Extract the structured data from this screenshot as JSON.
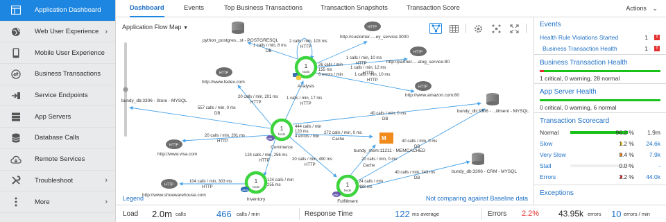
{
  "sidebar": {
    "items": [
      {
        "label": "Application Dashboard",
        "icon": "dashboard-icon",
        "has_submenu": false,
        "active": true
      },
      {
        "label": "Web User Experience",
        "icon": "globe-icon",
        "has_submenu": true
      },
      {
        "label": "Mobile User Experience",
        "icon": "mobile-icon",
        "has_submenu": false
      },
      {
        "label": "Business Transactions",
        "icon": "transactions-icon",
        "has_submenu": false
      },
      {
        "label": "Service Endpoints",
        "icon": "endpoint-icon",
        "has_submenu": false
      },
      {
        "label": "App Servers",
        "icon": "server-icon",
        "has_submenu": false
      },
      {
        "label": "Database Calls",
        "icon": "database-icon",
        "has_submenu": false
      },
      {
        "label": "Remote Services",
        "icon": "cloud-icon",
        "has_submenu": false
      },
      {
        "label": "Troubleshoot",
        "icon": "wrench-icon",
        "has_submenu": true
      },
      {
        "label": "More",
        "icon": "more-icon",
        "has_submenu": true
      }
    ]
  },
  "tabs": [
    {
      "label": "Dashboard",
      "active": true
    },
    {
      "label": "Events"
    },
    {
      "label": "Top Business Transactions"
    },
    {
      "label": "Transaction Snapshots"
    },
    {
      "label": "Transaction Score"
    }
  ],
  "actions_label": "Actions",
  "flow_map": {
    "title": "Application Flow Map",
    "legend": "Legend",
    "baseline_note": "Not comparing against Baseline data",
    "nodes": [
      {
        "id": "analysis",
        "count": "1",
        "unit": "Node",
        "name": "Analysis",
        "badge": "py"
      },
      {
        "id": "commerce",
        "count": "1",
        "unit": "Node",
        "name": "Commerce",
        "badge": "php"
      },
      {
        "id": "inventory",
        "count": "1",
        "unit": "Node",
        "name": "Inventory",
        "badge": "Java"
      },
      {
        "id": "fulfillment",
        "count": "1",
        "unit": "Node",
        "name": "Fulfillment",
        "badge": "php"
      }
    ],
    "backends": [
      {
        "label": "python_postgres...st - POSTGRESQL",
        "kind": "db"
      },
      {
        "label": "http://customer.....ey_service:3000",
        "kind": "http"
      },
      {
        "label": "http://partner.....alog_service:80",
        "kind": "http"
      },
      {
        "label": "http://www.fedex.com",
        "kind": "http"
      },
      {
        "label": "http://www.amazon.com:80",
        "kind": "http"
      },
      {
        "label": "bundy_db:3306 - Store - MYSQL",
        "kind": "db"
      },
      {
        "label": "bundy_db:3306 - ...illment - MYSQL",
        "kind": "db"
      },
      {
        "label": "http://www.visa.com",
        "kind": "http"
      },
      {
        "label": "bundy_mem:11211 - MEMCACHED",
        "kind": "cache"
      },
      {
        "label": "http://www.shoewarehouse.com",
        "kind": "http"
      },
      {
        "label": "bundy_db:3306 - CRM - MYSQL",
        "kind": "db"
      }
    ],
    "edge_labels": {
      "a_db": [
        "1 calls / min, 8 ms",
        "DB"
      ],
      "a_self": [
        "2 calls / min, 103 ms",
        "HTTP"
      ],
      "a_cust": [
        "1 calls / min, 10 ms",
        "HTTP"
      ],
      "a_partner": [
        "1 calls / min, 12 ms",
        "HTTP"
      ],
      "a_errors": [
        "26 calls / min",
        "155 ms",
        "6 errors / min"
      ],
      "a_amazon": [
        "1 calls / min, 10 ms",
        "HTTP"
      ],
      "c_fedex": [
        "20 calls / min, 201 ms",
        "HTTP"
      ],
      "c_analysis": [
        "1 calls / min, 17 ms",
        "HTTP"
      ],
      "c_store": [
        "557 calls / min, 0 ms",
        "DB"
      ],
      "c_fulfdb": [
        "40 calls / min, 0 ms",
        "DB"
      ],
      "c_stats": [
        "444 calls / min",
        "120 ms",
        "4 errors / min"
      ],
      "c_cache": [
        "272 calls / min, 0 ms",
        "Cache"
      ],
      "c_visa": [
        "20 calls / min, 201 ms",
        "HTTP"
      ],
      "c_inv": [
        "124 calls / min, 256 ms",
        "HTTP"
      ],
      "c_fulf": [
        "20 calls / min, 490 ms",
        "HTTP"
      ],
      "f_cache": [
        "20 calls / min, 0 ms",
        "Cache"
      ],
      "f_fulfdb": [
        "40 calls / min, 0 ms",
        "DB"
      ],
      "f_stats": [
        "24 calls / min",
        "488 ms"
      ],
      "f_crm": [
        "40 calls / min, 243 ms",
        "DB"
      ],
      "i_stats": [
        "124 calls / min",
        "255 ms"
      ],
      "i_shoe": [
        "104 calls / min, 303 ms",
        "HTTP"
      ]
    }
  },
  "events": {
    "title": "Events",
    "items": [
      {
        "label": "Health Rule Violations Started",
        "count": "1"
      },
      {
        "label": "Business Transaction Health",
        "count": "1"
      }
    ]
  },
  "bt_health": {
    "title": "Business Transaction Health",
    "summary": "1 critical, 0 warning, 28 normal",
    "critical_fraction": 0.034
  },
  "app_server_health": {
    "title": "App Server Health",
    "summary": "0 critical, 0 warning, 6 normal",
    "critical_fraction": 0
  },
  "scorecard": {
    "title": "Transaction Scorecard",
    "rows": [
      {
        "label": "Normal",
        "pct": "96.2 %",
        "value": "1.9m",
        "fill": 0.962,
        "color": "#19c319",
        "linked": false
      },
      {
        "label": "Slow",
        "pct": "1.2 %",
        "value": "24.6k",
        "fill": 0.012,
        "color": "#f2c40c",
        "linked": true
      },
      {
        "label": "Very Slow",
        "pct": "0.4 %",
        "value": "7.9k",
        "fill": 0.004,
        "color": "#f08a1a",
        "linked": true
      },
      {
        "label": "Stall",
        "pct": "0.0 %",
        "value": "-",
        "fill": 0,
        "color": "#9b59b6",
        "linked": true
      },
      {
        "label": "Errors",
        "pct": "2.2 %",
        "value": "44.0k",
        "fill": 0.022,
        "color": "#e53030",
        "linked": true
      }
    ]
  },
  "exceptions_title": "Exceptions",
  "stats": {
    "load_label": "Load",
    "load_total": "2.0m",
    "load_total_unit": "calls",
    "load_rate": "466",
    "load_rate_unit": "calls / min",
    "response_label": "Response Time",
    "response_value": "122",
    "response_unit": "ms average",
    "errors_label": "Errors",
    "errors_pct": "2.2%",
    "errors_total": "43.95k",
    "errors_total_unit": "errors",
    "errors_rate": "10",
    "errors_rate_unit": "errors / min"
  },
  "colors": {
    "accent": "#1d86e0",
    "node_ring": "#3ed43e",
    "edge": "#4aa3e8",
    "critical": "#e53030",
    "normal": "#19c319"
  }
}
